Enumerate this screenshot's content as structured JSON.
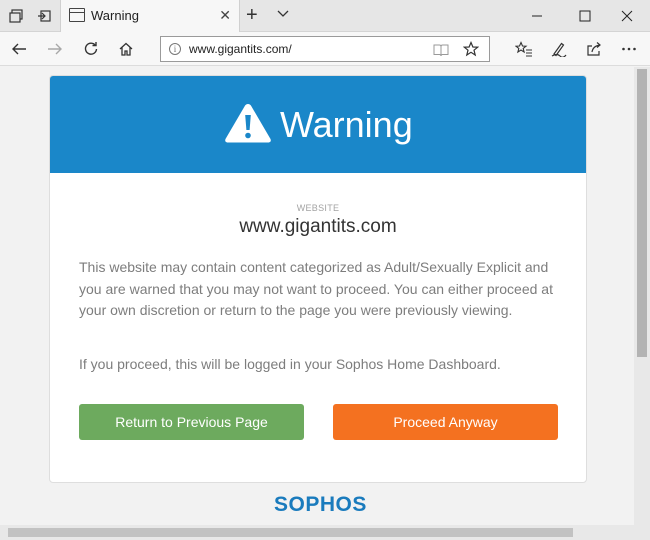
{
  "browser": {
    "tab_title": "Warning",
    "url": "www.gigantits.com/",
    "tab_icons": [
      "tab-list-icon",
      "set-aside-tabs-icon",
      "page-icon",
      "close-icon",
      "plus-icon",
      "chevron-down-icon"
    ],
    "window_controls": [
      "minimize-icon",
      "maximize-icon",
      "close-icon"
    ],
    "nav_icons": [
      "back-arrow-icon",
      "forward-arrow-icon",
      "refresh-icon",
      "home-icon"
    ],
    "address_icons": [
      "info-icon",
      "reading-view-icon",
      "star-icon"
    ],
    "toolbar_icons": [
      "favorites-icon",
      "pen-icon",
      "share-icon",
      "more-icon"
    ]
  },
  "warning": {
    "header_title": "Warning",
    "site_label": "WEBSITE",
    "site_name": "www.gigantits.com",
    "message": "This website may contain content categorized as Adult/Sexually Explicit and you are warned that you may not want to proceed. You can either proceed at your own discretion or return to the page you were previously viewing.",
    "logged_message": "If you proceed, this will be logged in your Sophos Home Dashboard.",
    "return_button": "Return to Previous Page",
    "proceed_button": "Proceed Anyway",
    "brand": "SOPHOS"
  },
  "colors": {
    "header_blue": "#1a87c9",
    "return_green": "#6daa5e",
    "proceed_orange": "#f47120",
    "brand_blue": "#1a7bbd"
  }
}
